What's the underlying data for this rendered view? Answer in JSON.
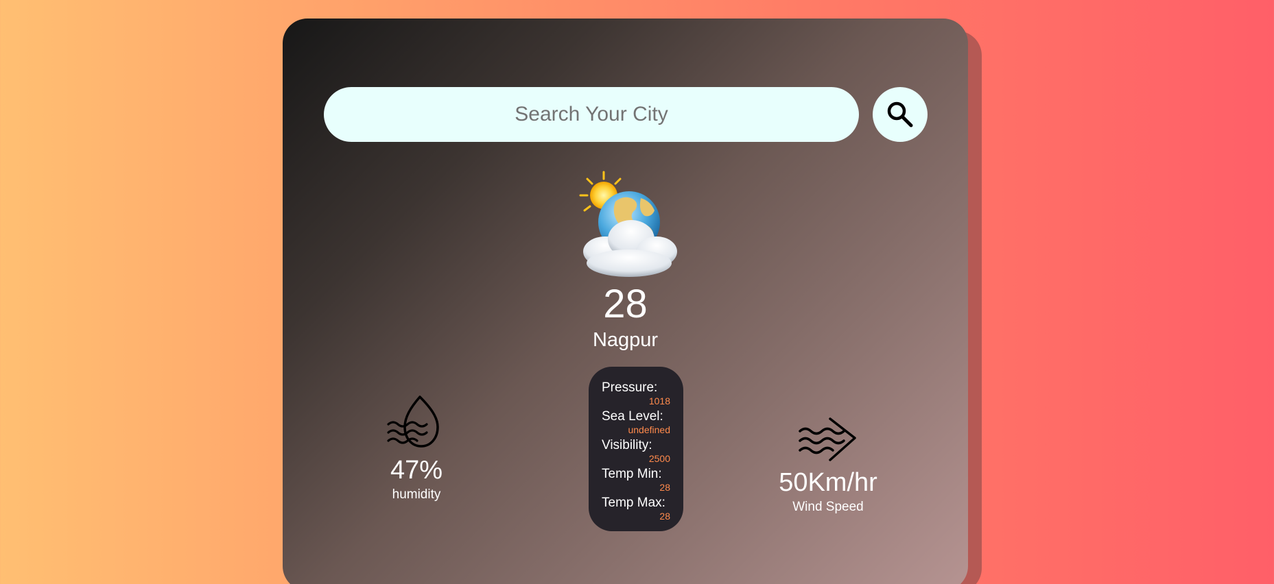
{
  "search": {
    "placeholder": "Search Your City",
    "button_icon": "search-icon"
  },
  "weather": {
    "icon": "sun-globe-clouds-icon",
    "temperature": "28",
    "city": "Nagpur"
  },
  "humidity": {
    "icon": "humidity-drop-icon",
    "value": "47%",
    "label": "humidity"
  },
  "wind": {
    "icon": "wind-icon",
    "value": "50Km/hr",
    "label": "Wind Speed"
  },
  "details": [
    {
      "label": "Pressure:",
      "value": "1018"
    },
    {
      "label": "Sea Level:",
      "value": "undefined"
    },
    {
      "label": "Visibility:",
      "value": "2500"
    },
    {
      "label": "Temp Min:",
      "value": "28"
    },
    {
      "label": "Temp Max:",
      "value": "28"
    }
  ],
  "colors": {
    "accent_value": "#ff8a4c",
    "search_bg": "#e8fffd",
    "details_bg": "#26232a"
  }
}
